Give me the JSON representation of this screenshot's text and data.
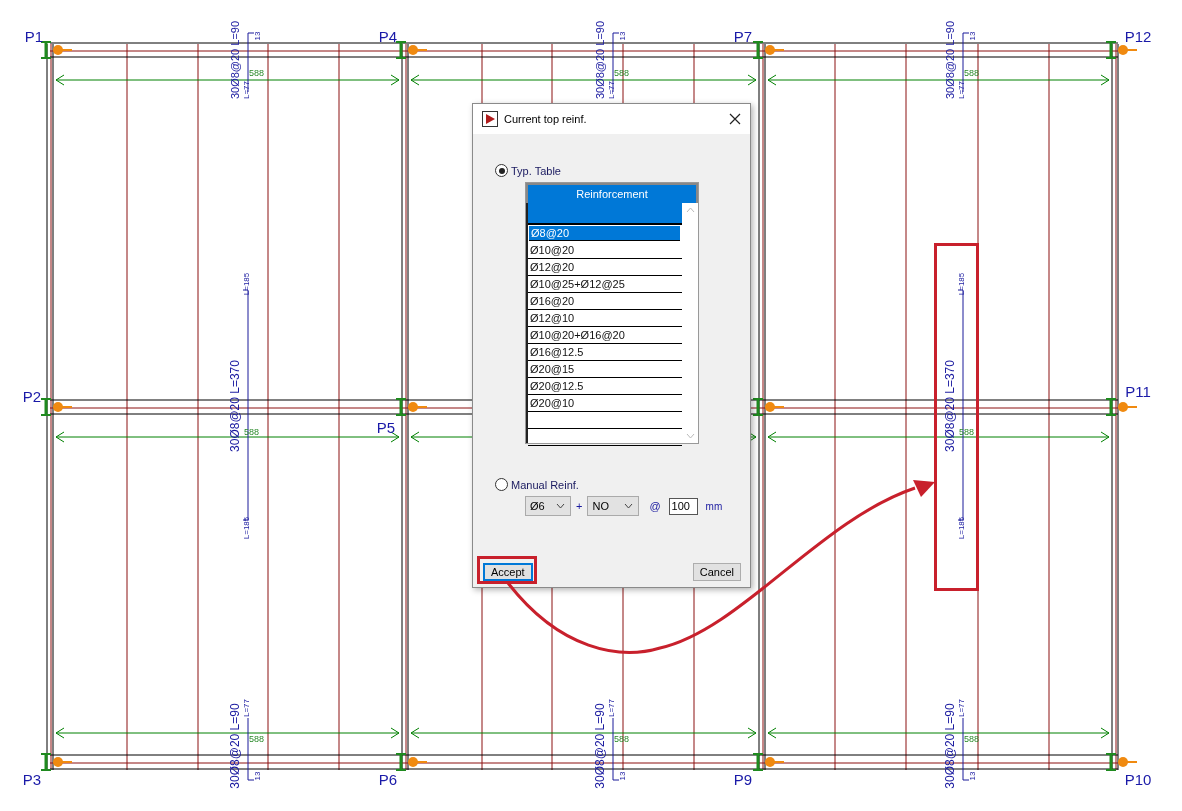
{
  "pillars": [
    {
      "label": "P1"
    },
    {
      "label": "P4"
    },
    {
      "label": "P7"
    },
    {
      "label": "P12"
    },
    {
      "label": "P2"
    },
    {
      "label": "P5"
    },
    {
      "label": "P11"
    },
    {
      "label": "P3"
    },
    {
      "label": "P6"
    },
    {
      "label": "P9"
    },
    {
      "label": "P10"
    }
  ],
  "top_bars": [
    {
      "label": "30Ø8@20 L=90",
      "anchor_length": "L=77",
      "hook": "13",
      "span": "588"
    },
    {
      "label": "30Ø8@20 L=90",
      "anchor_length": "L=77",
      "hook": "13",
      "span": "588"
    },
    {
      "label": "30Ø8@20 L=90",
      "anchor_length": "L=77",
      "hook": "13",
      "span": "588"
    }
  ],
  "middle_bars": [
    {
      "label": "30Ø8@20 L=370",
      "left_length": "L=185",
      "right_length": "L=185",
      "span": "588"
    },
    {
      "label": "30Ø8@20 L=370",
      "left_length": "L=185",
      "right_length": "L=185",
      "span": "588"
    }
  ],
  "bottom_bars": [
    {
      "label": "30Ø8@20 L=90",
      "anchor_length": "L=77",
      "hook": "13",
      "span": "588"
    },
    {
      "label": "30Ø8@20 L=90",
      "anchor_length": "L=77",
      "hook": "13",
      "span": "588"
    },
    {
      "label": "30Ø8@20 L=90",
      "anchor_length": "L=77",
      "hook": "13",
      "span": "588"
    }
  ],
  "dialog": {
    "title": "Current top reinf.",
    "typ_table": {
      "label": "Typ. Table",
      "selected": true
    },
    "table": {
      "header": "Reinforcement",
      "rows": [
        {
          "text": "Ø8@20",
          "selected": true
        },
        {
          "text": "Ø10@20",
          "selected": false
        },
        {
          "text": "Ø12@20",
          "selected": false
        },
        {
          "text": "Ø10@25+Ø12@25",
          "selected": false
        },
        {
          "text": "Ø16@20",
          "selected": false
        },
        {
          "text": "Ø12@10",
          "selected": false
        },
        {
          "text": "Ø10@20+Ø16@20",
          "selected": false
        },
        {
          "text": "Ø16@12.5",
          "selected": false
        },
        {
          "text": "Ø20@15",
          "selected": false
        },
        {
          "text": "Ø20@12.5",
          "selected": false
        },
        {
          "text": "Ø20@10",
          "selected": false
        }
      ]
    },
    "manual": {
      "label": "Manual Reinf.",
      "selected": false,
      "bar": "Ø6",
      "plus": "+",
      "extra": "NO",
      "at": "@",
      "spacing": "100",
      "unit": "mm"
    },
    "buttons": [
      {
        "label": "Accept",
        "focused": true
      },
      {
        "label": "Cancel",
        "focused": false
      }
    ]
  }
}
